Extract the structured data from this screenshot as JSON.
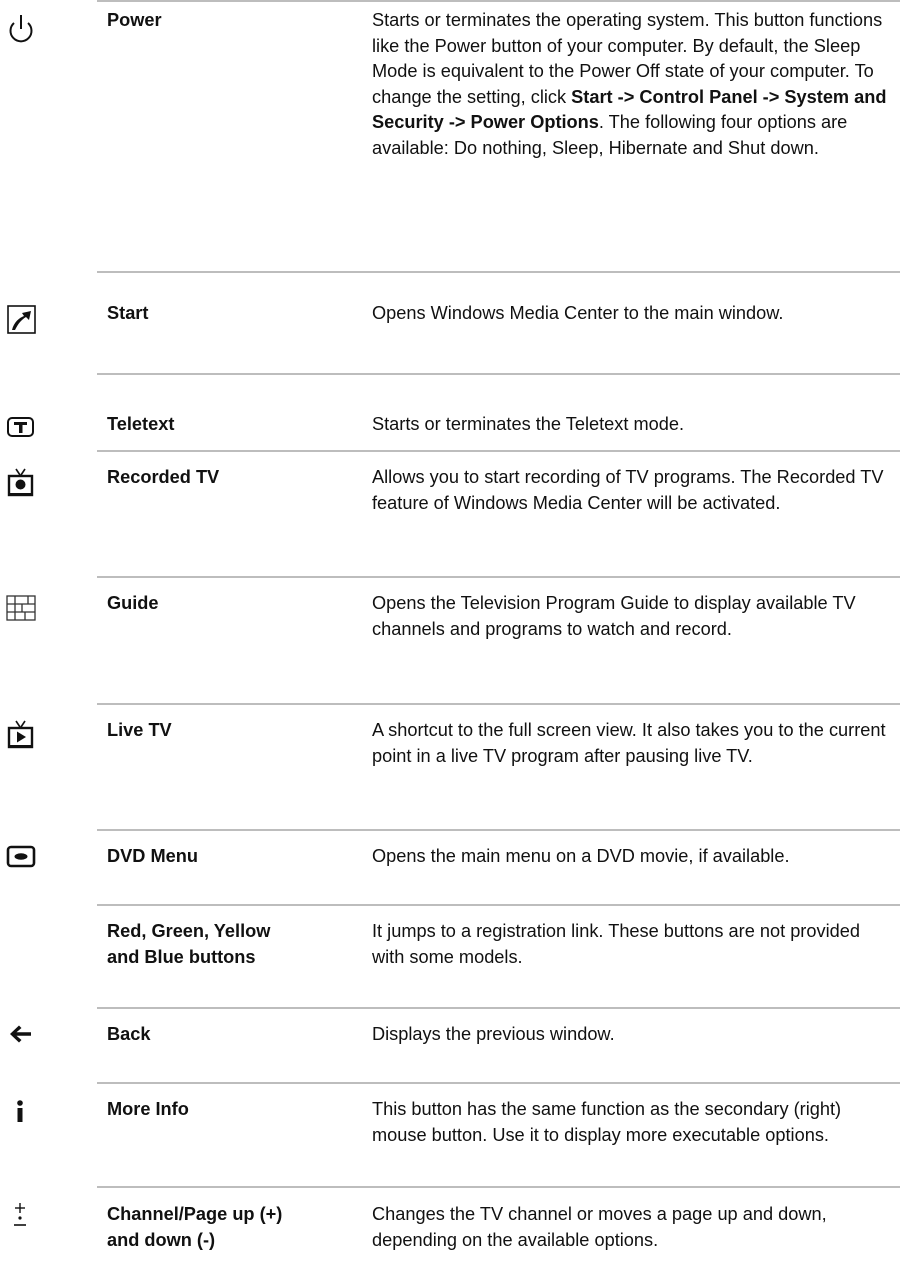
{
  "rows": [
    {
      "id": "power",
      "icon": "power-icon",
      "name": "Power",
      "desc_parts": {
        "p1": "Starts or terminates the operating system. This button functions like the Power button of your computer. By default, the Sleep Mode is equivalent to the Power Off state of your computer. To change the setting, click ",
        "b1": "Start -> Control Panel -> System and Security -> Power Options",
        "p2": ". The following four options are available: Do nothing, Sleep, Hibernate and Shut down."
      }
    },
    {
      "id": "start",
      "icon": "start-icon",
      "name": "Start",
      "desc": "Opens Windows Media Center to the main window."
    },
    {
      "id": "teletext",
      "icon": "teletext-icon",
      "name": "Teletext",
      "desc": "Starts or terminates the Teletext mode."
    },
    {
      "id": "recorded-tv",
      "icon": "recorded-tv-icon",
      "name": "Recorded TV",
      "desc": "Allows you to start recording of TV programs. The Recorded TV feature of Windows Media Center will be activated."
    },
    {
      "id": "guide",
      "icon": "guide-icon",
      "name": "Guide",
      "desc": "Opens the Television Program Guide to display available TV channels and programs to watch and record."
    },
    {
      "id": "live-tv",
      "icon": "live-tv-icon",
      "name": "Live TV",
      "desc": "A shortcut to the full screen view. It also takes you to the current point in a live TV program after pausing live TV."
    },
    {
      "id": "dvd-menu",
      "icon": "dvd-menu-icon",
      "name": "DVD Menu",
      "desc": "Opens the main menu on a DVD movie, if available."
    },
    {
      "id": "color-buttons",
      "icon": "",
      "name": "Red, Green, Yellow\nand Blue buttons",
      "desc": "It jumps to a registration link. These buttons are not provided with some models."
    },
    {
      "id": "back",
      "icon": "back-arrow-icon",
      "name": "Back",
      "desc": "Displays the previous window."
    },
    {
      "id": "more-info",
      "icon": "info-icon",
      "name": "More Info",
      "desc": "This button has the same function as the secondary (right) mouse button. Use it to display more executable options."
    },
    {
      "id": "channel-page",
      "icon": "channel-page-icon",
      "name": "Channel/Page up (+)\nand down (-)",
      "desc": "Changes the TV channel or moves a page up and down, depending on the available options."
    }
  ]
}
